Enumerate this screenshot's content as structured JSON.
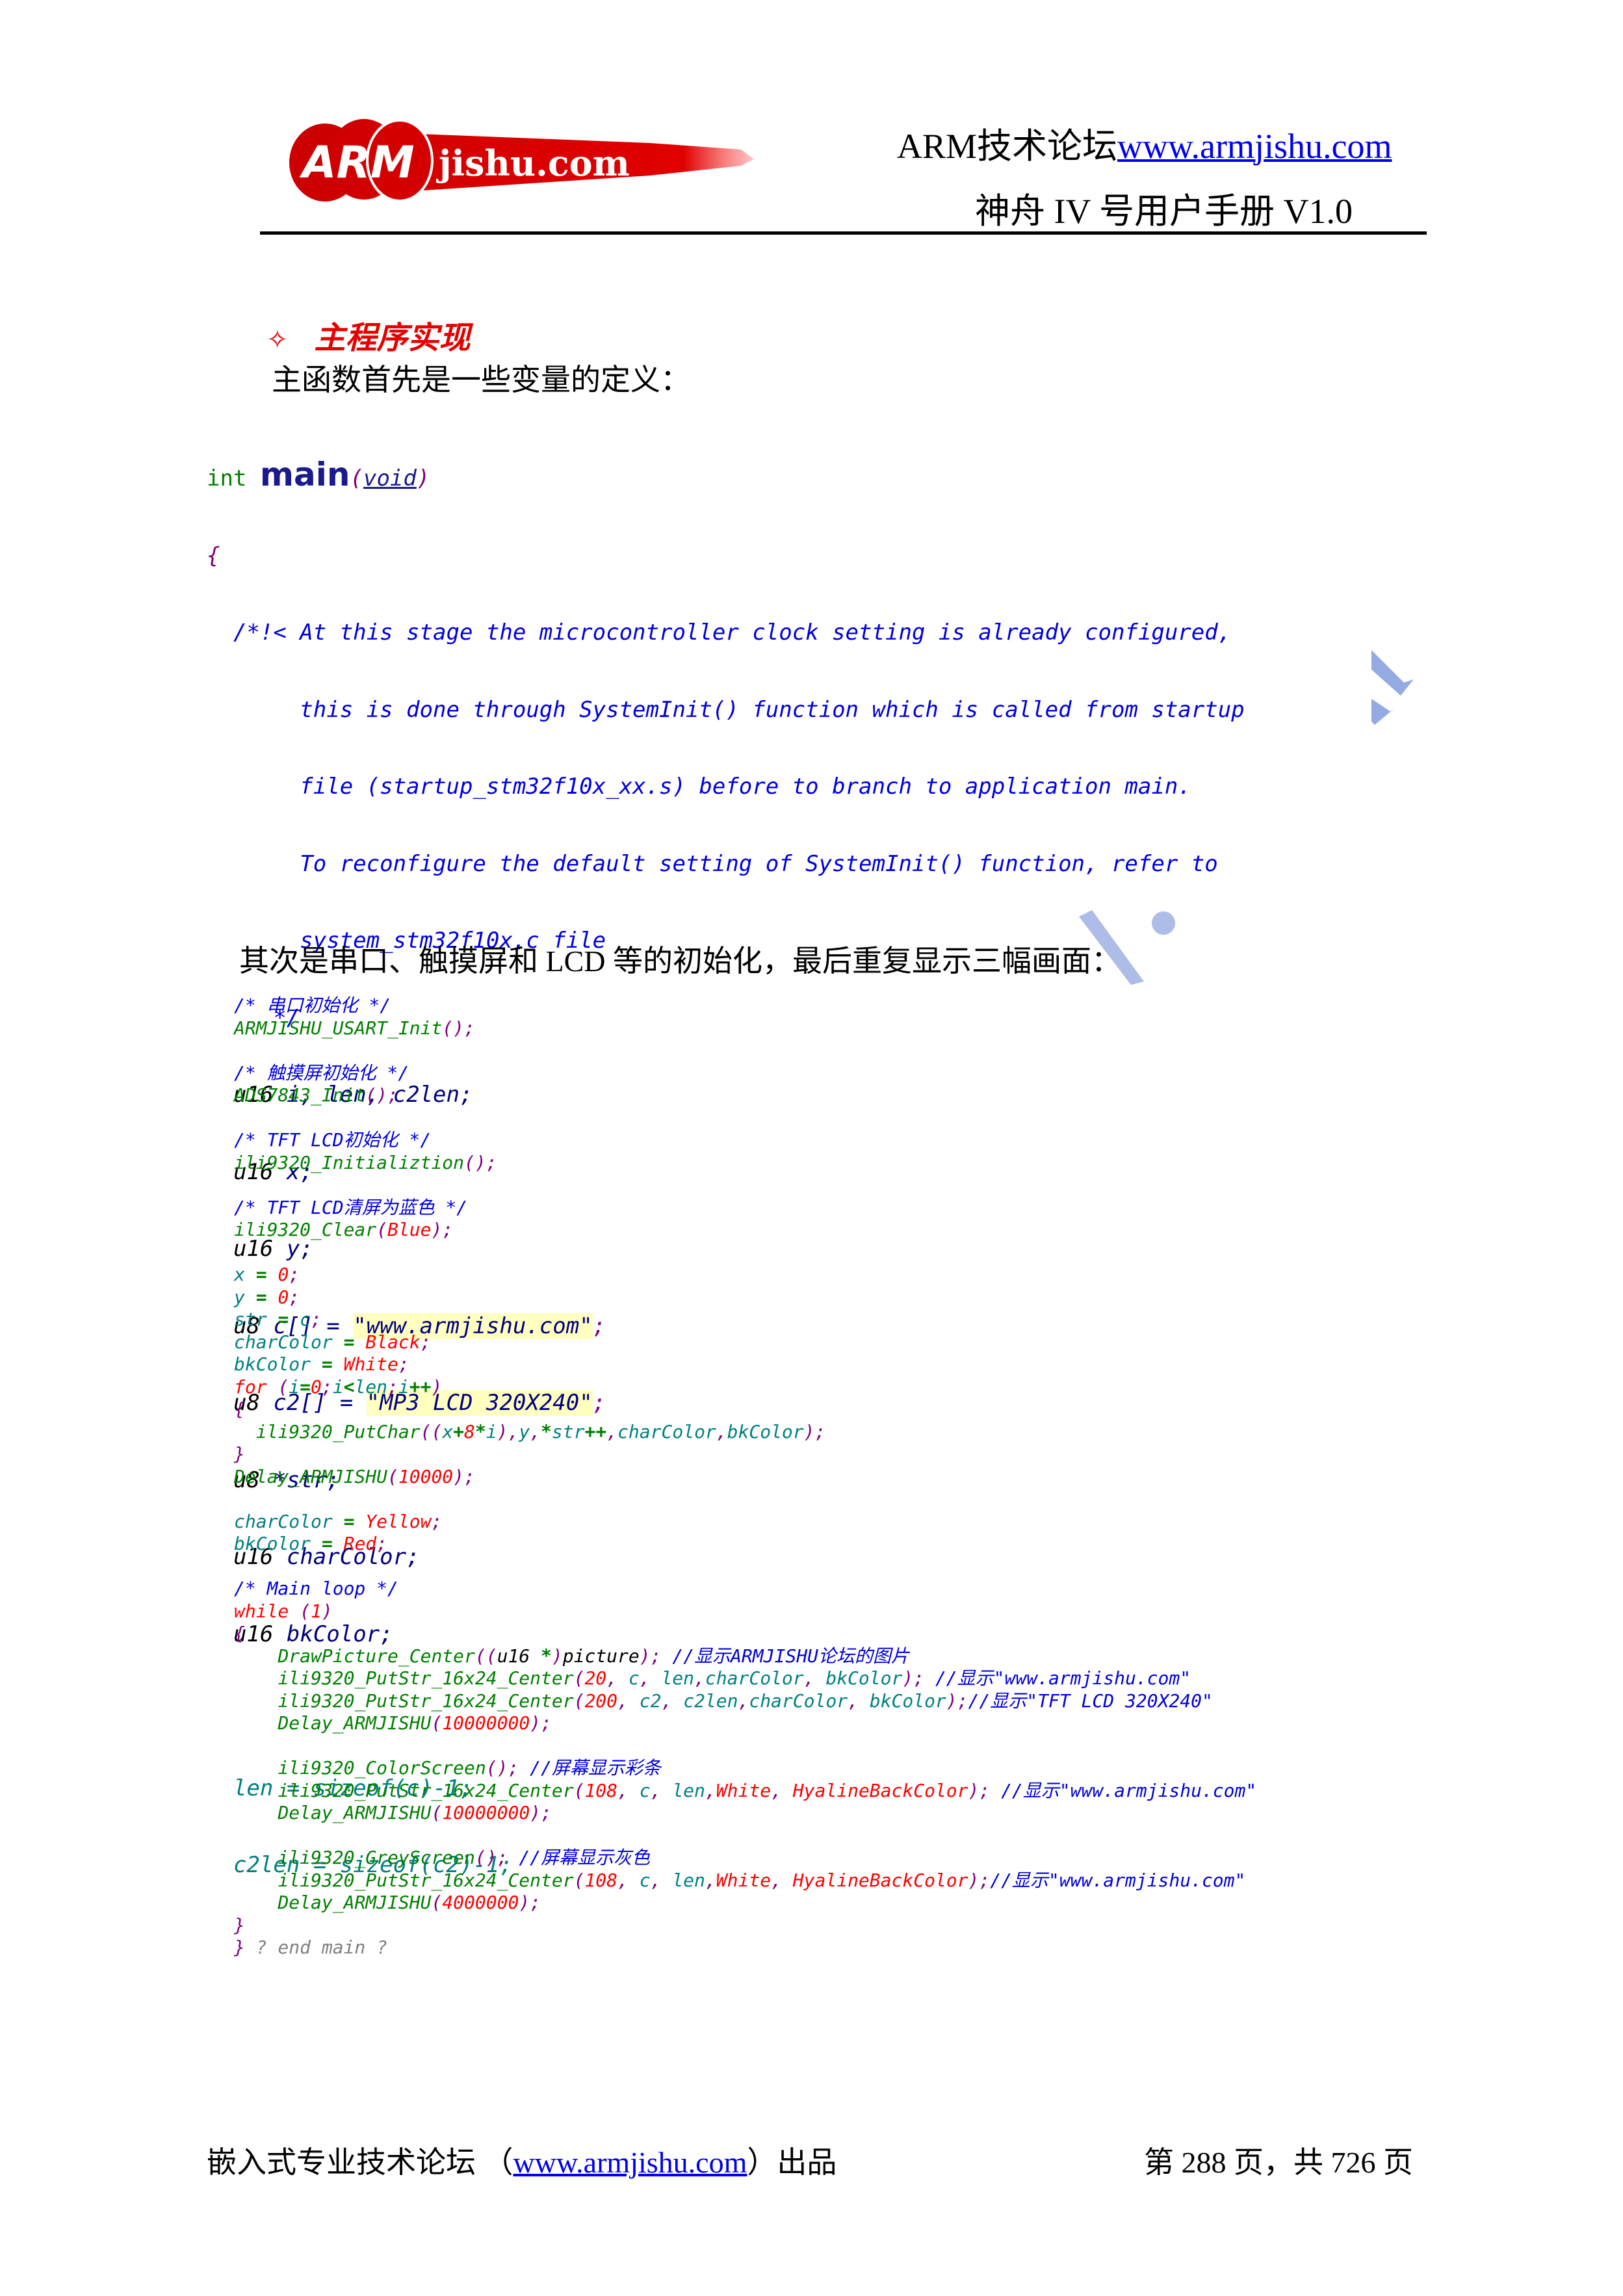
{
  "header": {
    "logo_text_arm": "ARM",
    "logo_text_rest": "jishu.com",
    "forum_label": "ARM技术论坛",
    "forum_url": "www.armjishu.com",
    "manual_title": "神舟 IV 号用户手册  V1.0"
  },
  "section": {
    "bullet": "✧",
    "title": "主程序实现",
    "intro": "主函数首先是一些变量的定义：",
    "second_intro": "其次是串口、触摸屏和 LCD 等的初始化，最后重复显示三幅画面："
  },
  "code_block_1": {
    "sig_type": "int",
    "sig_name": "main",
    "sig_open": "(",
    "sig_param": "void",
    "sig_close": ")",
    "open_brace": "{",
    "comment_lines": [
      "/*!< At this stage the microcontroller clock setting is already configured,",
      "     this is done through SystemInit() function which is called from startup",
      "     file (startup_stm32f10x_xx.s) before to branch to application main.",
      "     To reconfigure the default setting of SystemInit() function, refer to",
      "     system_stm32f10x.c file",
      "   */"
    ],
    "decls": [
      {
        "type": "u16",
        "rest": " i, len, c2len;"
      },
      {
        "type": "u16",
        "rest": " x;"
      },
      {
        "type": "u16",
        "rest": " y;"
      },
      {
        "type": "u8",
        "rest_pre": " c[] = ",
        "str": "\"www.armjishu.com\"",
        "rest_post": ";"
      },
      {
        "type": "u8",
        "rest_pre": " c2[] = ",
        "str": "\"MP3 LCD 320X240\"",
        "rest_post": ";"
      },
      {
        "type": "u8",
        "rest": " *str;"
      },
      {
        "type": "u16",
        "rest": " charColor;"
      },
      {
        "type": "u16",
        "rest": " bkColor;"
      }
    ],
    "assign_lines": [
      "len = sizeof(c)-1;",
      "c2len = sizeof(c2)-1;"
    ]
  },
  "code_block_2": {
    "lines": [
      "/* 串口初始化 */",
      "ARMJISHU_USART_Init();",
      "",
      "/* 触摸屏初始化 */",
      "ADS7843_Init();",
      "",
      "/* TFT LCD初始化 */",
      "ili9320_Initializtion();",
      "",
      "/* TFT LCD清屏为蓝色 */",
      "ili9320_Clear(Blue);",
      "",
      "x = 0;",
      "y = 0;",
      "str = c;",
      "charColor = Black;",
      "bkColor = White;",
      "for (i=0;i<len;i++)",
      "{",
      "  ili9320_PutChar((x+8*i),y,*str++,charColor,bkColor);",
      "}",
      "Delay_ARMJISHU(10000);",
      "",
      "charColor = Yellow;",
      "bkColor = Red;",
      "",
      "/* Main loop */",
      "while (1)",
      "{",
      "    DrawPicture_Center((u16 *)picture); //显示ARMJISHU论坛的图片",
      "    ili9320_PutStr_16x24_Center(20, c, len,charColor, bkColor); //显示\"www.armjishu.com\"",
      "    ili9320_PutStr_16x24_Center(200, c2, c2len,charColor, bkColor);//显示\"TFT LCD 320X240\"",
      "    Delay_ARMJISHU(10000000);",
      "",
      "    ili9320_ColorScreen(); //屏幕显示彩条",
      "    ili9320_PutStr_16x24_Center(108, c, len,White, HyalineBackColor); //显示\"www.armjishu.com\"",
      "    Delay_ARMJISHU(10000000);",
      "",
      "    ili9320_GreyScreen(); //屏幕显示灰色",
      "    ili9320_PutStr_16x24_Center(108, c, len,White, HyalineBackColor);//显示\"www.armjishu.com\"",
      "    Delay_ARMJISHU(4000000);",
      "}",
      "} ? end main ?"
    ]
  },
  "footer": {
    "left_prefix": "嵌入式专业技术论坛  （",
    "left_url": "www.armjishu.com",
    "left_suffix": "）出品",
    "page_prefix": "第 ",
    "page_current": "288",
    "page_mid": " 页，共 ",
    "page_total": "726",
    "page_suffix": " 页"
  },
  "colors": {
    "comment": "#0000e0",
    "function": "#008000",
    "number_keyword": "#ff0000",
    "punctuation": "#800080",
    "variable": "#008080",
    "string_bg": "#ffffc0",
    "heading": "#e60000",
    "link": "#0000ee"
  }
}
